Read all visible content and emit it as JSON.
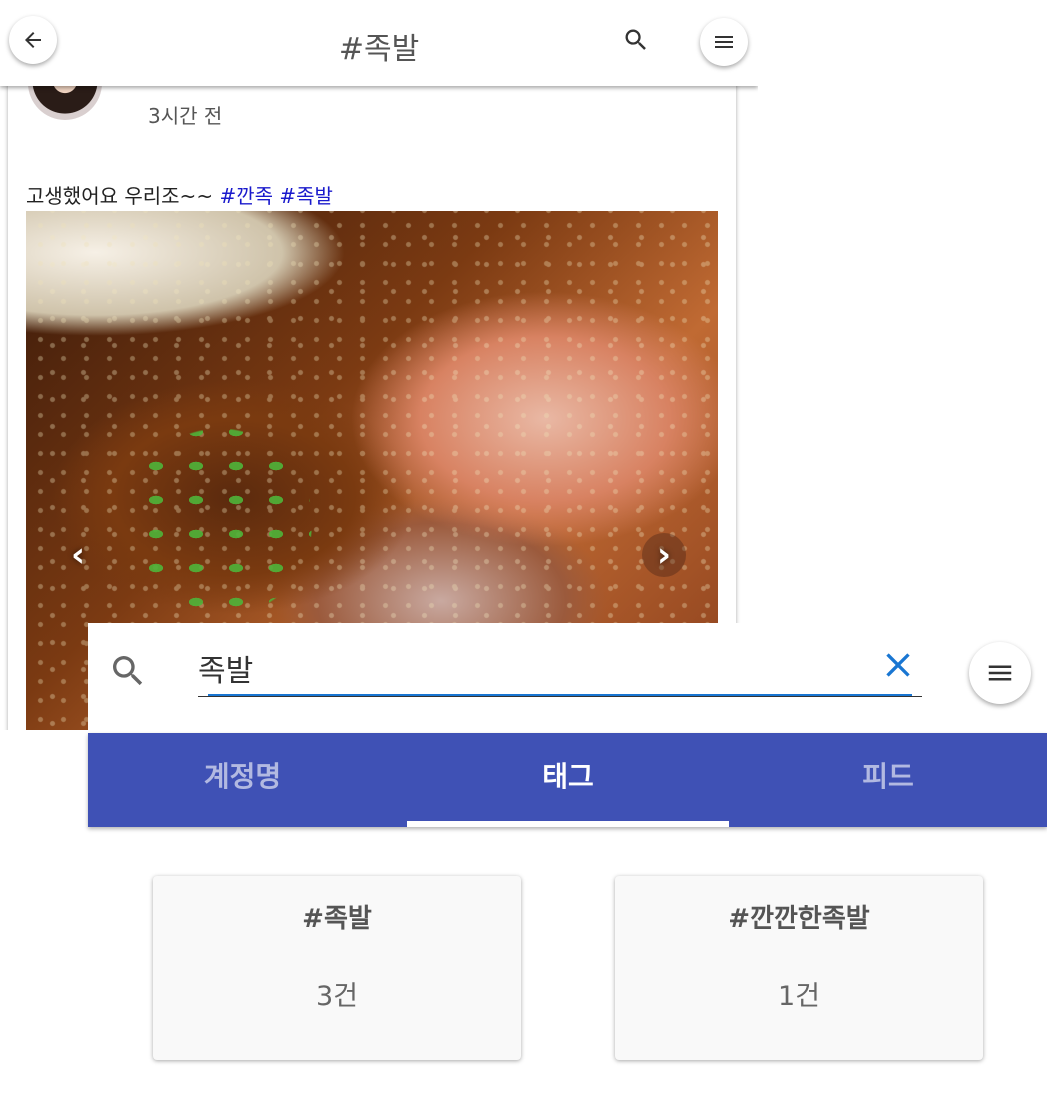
{
  "feed_screen": {
    "header": {
      "title": "#족발",
      "back_icon": "arrow-left-icon",
      "search_icon": "search-icon",
      "menu_icon": "hamburger-menu-icon"
    },
    "post": {
      "time_ago": "3시간 전",
      "caption_text": "고생했어요 우리조~~ ",
      "hashtags": [
        "#깐족",
        "#족발"
      ],
      "hashtag_color": "#1a1acc",
      "prev_arrow": "‹",
      "next_arrow": "›"
    }
  },
  "search_screen": {
    "search": {
      "value": "족발",
      "search_icon": "search-icon",
      "clear_icon": "close-icon",
      "accent_color": "#1976d2"
    },
    "tabs": [
      {
        "label": "계정명",
        "active": false
      },
      {
        "label": "태그",
        "active": true
      },
      {
        "label": "피드",
        "active": false
      }
    ],
    "tab_bar_color": "#3f51b5",
    "results": [
      {
        "tag": "#족발",
        "count": "3건"
      },
      {
        "tag": "#깐깐한족발",
        "count": "1건"
      }
    ]
  }
}
